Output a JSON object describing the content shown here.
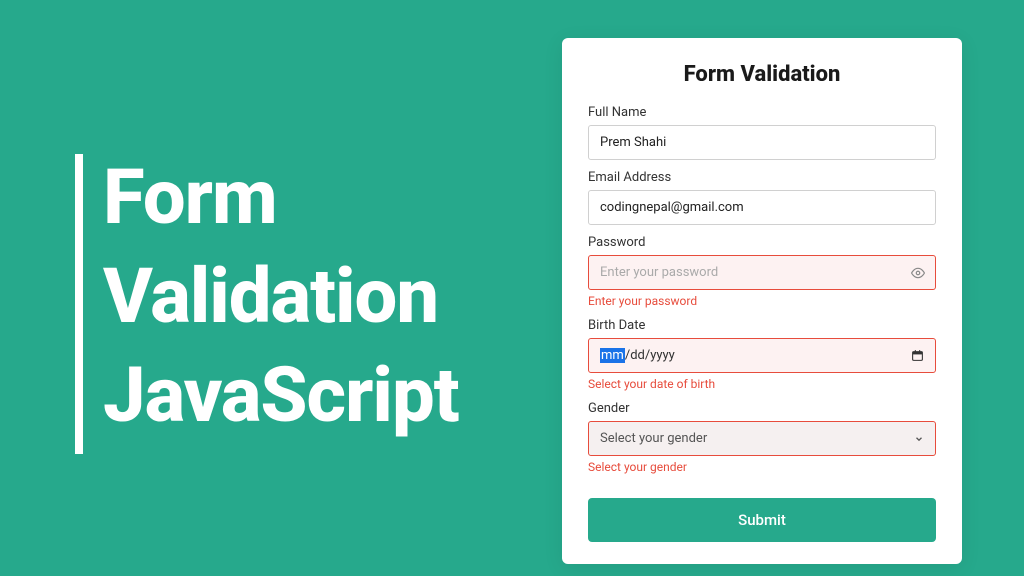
{
  "hero": {
    "line1": "Form",
    "line2": "Validation",
    "line3": "JavaScript"
  },
  "form": {
    "title": "Form Validation",
    "fullname": {
      "label": "Full Name",
      "value": "Prem Shahi"
    },
    "email": {
      "label": "Email Address",
      "value": "codingnepal@gmail.com"
    },
    "password": {
      "label": "Password",
      "placeholder": "Enter your password",
      "error": "Enter your password"
    },
    "birthdate": {
      "label": "Birth Date",
      "mm": "mm",
      "dd": "dd",
      "yyyy": "yyyy",
      "error": "Select your date of birth"
    },
    "gender": {
      "label": "Gender",
      "placeholder": "Select your gender",
      "error": "Select your gender"
    },
    "submit": "Submit"
  },
  "colors": {
    "brand": "#26a98c",
    "error": "#e74c3c"
  }
}
